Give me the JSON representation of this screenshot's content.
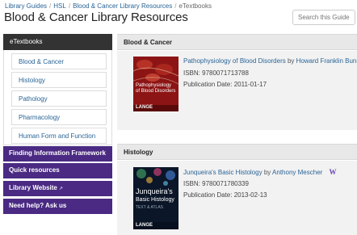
{
  "breadcrumb": {
    "items": [
      "Library Guides",
      "HSL",
      "Blood & Cancer Library Resources",
      "eTextbooks"
    ]
  },
  "title": "Blood & Cancer Library Resources",
  "search": {
    "placeholder": "Search this Guide"
  },
  "sidebar": {
    "header": "eTextbooks",
    "items": [
      {
        "label": "Blood & Cancer"
      },
      {
        "label": "Histology"
      },
      {
        "label": "Pathology"
      },
      {
        "label": "Pharmacology"
      },
      {
        "label": "Human Form and Function"
      }
    ],
    "purple_links": [
      {
        "label": "Finding Information Framework"
      },
      {
        "label": "Quick resources"
      },
      {
        "label": "Library Website"
      },
      {
        "label": "Need help? Ask us"
      }
    ]
  },
  "sections": [
    {
      "heading": "Blood & Cancer",
      "book": {
        "title": "Pathophysiology of Blood Disorders",
        "by": "by",
        "author": "Howard Franklin Bunn;",
        "isbn": "ISBN: 9780071713788",
        "date": "Publication Date: 2011-01-17",
        "cover_text": "Pathophysiology of Blood Disorders",
        "cover_brand": "LANGE"
      }
    },
    {
      "heading": "Histology",
      "book": {
        "title": "Junqueira's Basic Histology",
        "by": "by",
        "author": "Anthony Mescher",
        "isbn": "ISBN: 9780071780339",
        "date": "Publication Date: 2013-02-13",
        "cover_text_1": "Junqueira's",
        "cover_text_2": "Basic Histology",
        "cover_text_3": "TEXT & ATLAS",
        "cover_brand": "LANGE"
      }
    }
  ],
  "colors": {
    "purple": "#4a2a83",
    "uw_gold": "#8a6fd1"
  }
}
